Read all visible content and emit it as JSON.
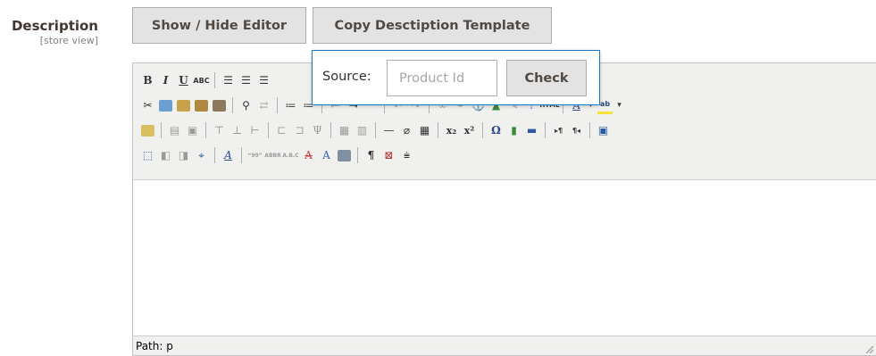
{
  "field": {
    "label": "Description",
    "scope": "[store view]"
  },
  "buttons": {
    "toggle_editor": "Show / Hide Editor",
    "copy_template": "Copy Desctiption Template"
  },
  "popup": {
    "source_label": "Source:",
    "input_placeholder": "Product Id",
    "input_value": "",
    "check_label": "Check"
  },
  "editor": {
    "status_path": "Path: p"
  },
  "toolbar": {
    "row1": [
      "bold-icon",
      "italic-icon",
      "underline-icon",
      "strikethrough-icon",
      "align-left-icon",
      "align-center-icon",
      "align-right-icon"
    ],
    "row2": [
      "cut-icon",
      "copy-icon",
      "paste-icon",
      "paste-text-icon",
      "paste-word-icon",
      "find-icon",
      "replace-icon",
      "bullet-list-icon",
      "numbered-list-icon",
      "outdent-icon",
      "indent-icon",
      "blockquote-icon",
      "undo-icon",
      "redo-icon",
      "link-icon",
      "unlink-icon",
      "anchor-icon",
      "image-icon",
      "cleanup-icon",
      "help-icon",
      "html-icon",
      "text-color-icon",
      "highlight-color-icon"
    ],
    "row3": [
      "table-icon",
      "row-props-icon",
      "cell-props-icon",
      "insert-row-before-icon",
      "insert-row-after-icon",
      "delete-row-icon",
      "insert-col-before-icon",
      "insert-col-after-icon",
      "delete-col-icon",
      "split-cells-icon",
      "merge-cells-icon",
      "horizontal-rule-icon",
      "remove-format-icon",
      "visual-aid-icon",
      "subscript-icon",
      "superscript-icon",
      "special-char-icon",
      "media-icon",
      "separator-icon",
      "ltr-icon",
      "rtl-icon",
      "fullscreen-icon"
    ],
    "row4": [
      "insert-layer-icon",
      "move-forward-icon",
      "move-backward-icon",
      "absolute-icon",
      "styles-icon",
      "cite-icon",
      "abbr-icon",
      "acronym-icon",
      "del-icon",
      "ins-icon",
      "attributes-icon",
      "show-blocks-icon",
      "non-breaking-icon",
      "page-break-icon"
    ]
  }
}
